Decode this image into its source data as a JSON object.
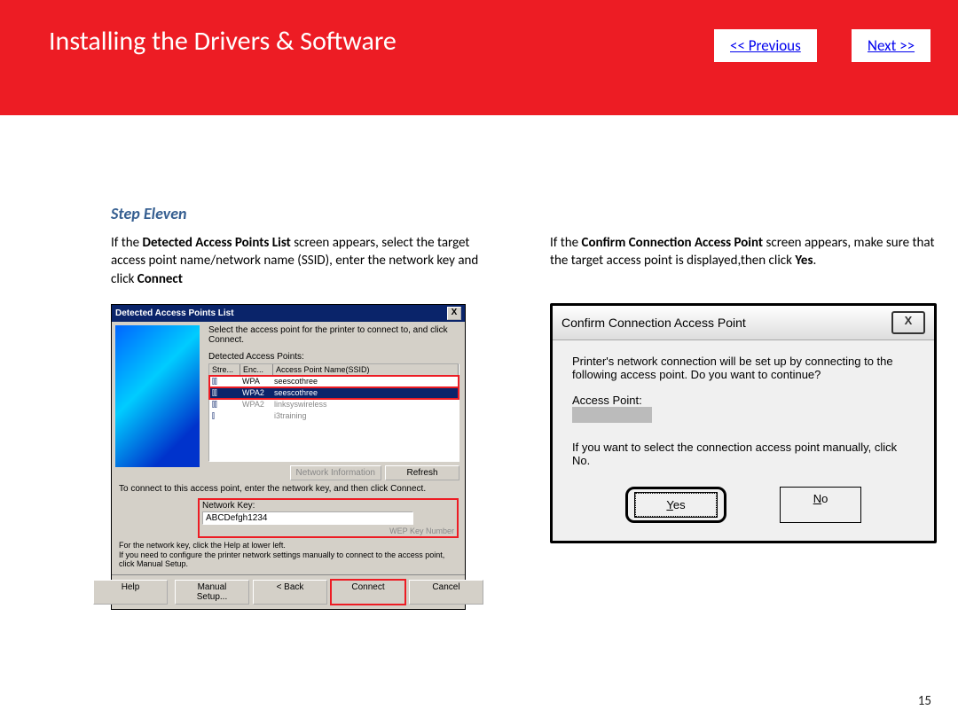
{
  "header": {
    "title": "Installing  the Drivers & Software",
    "prev": "<< Previous",
    "next": "Next >>"
  },
  "step": {
    "title": "Step Eleven"
  },
  "left": {
    "text_before_bold1": "If the ",
    "bold1": "Detected Access Points List",
    "text_mid": " screen appears, select the target access point name/network name (SSID), enter the network key and click ",
    "bold2": "Connect"
  },
  "right": {
    "text_before_bold1": "If the ",
    "bold1": "Confirm Connection Access Point",
    "text_mid": " screen appears, make sure that the target access point is displayed,then click ",
    "bold2": "Yes",
    "text_after": "."
  },
  "win1": {
    "title": "Detected Access Points List",
    "close": "X",
    "instruction": "Select the access point for the printer to connect to, and click Connect.",
    "list_label": "Detected Access Points:",
    "cols": {
      "stre": "Stre...",
      "enc": "Enc...",
      "ssid": "Access Point Name(SSID)"
    },
    "rows": [
      {
        "enc": "WPA",
        "ssid": "seescothree"
      },
      {
        "enc": "WPA2",
        "ssid": "seescothree"
      },
      {
        "enc": "WPA2",
        "ssid": "linksyswireless"
      },
      {
        "enc": "",
        "ssid": "i3training"
      }
    ],
    "net_info": "Network Information",
    "refresh": "Refresh",
    "connect_hint": "To connect to this access point, enter the network key, and then click Connect.",
    "net_key_label": "Network Key:",
    "net_key_value": "ABCDefgh1234",
    "wep": "WEP Key Number",
    "fine": "For the network key, click the Help at lower left.\nIf you need to configure the printer network settings manually to connect to the access point, click Manual Setup.",
    "help": "Help",
    "manual": "Manual Setup...",
    "back": "< Back",
    "connect": "Connect",
    "cancel": "Cancel"
  },
  "dlg": {
    "title": "Confirm Connection Access Point",
    "close": "X",
    "msg": "Printer's network connection will be set up by connecting to the following access point. Do you want to continue?",
    "ap_label": "Access Point:",
    "manual_msg": "If you want to select the connection access point manually, click No.",
    "yes": "Yes",
    "no": "No"
  },
  "page": "15"
}
